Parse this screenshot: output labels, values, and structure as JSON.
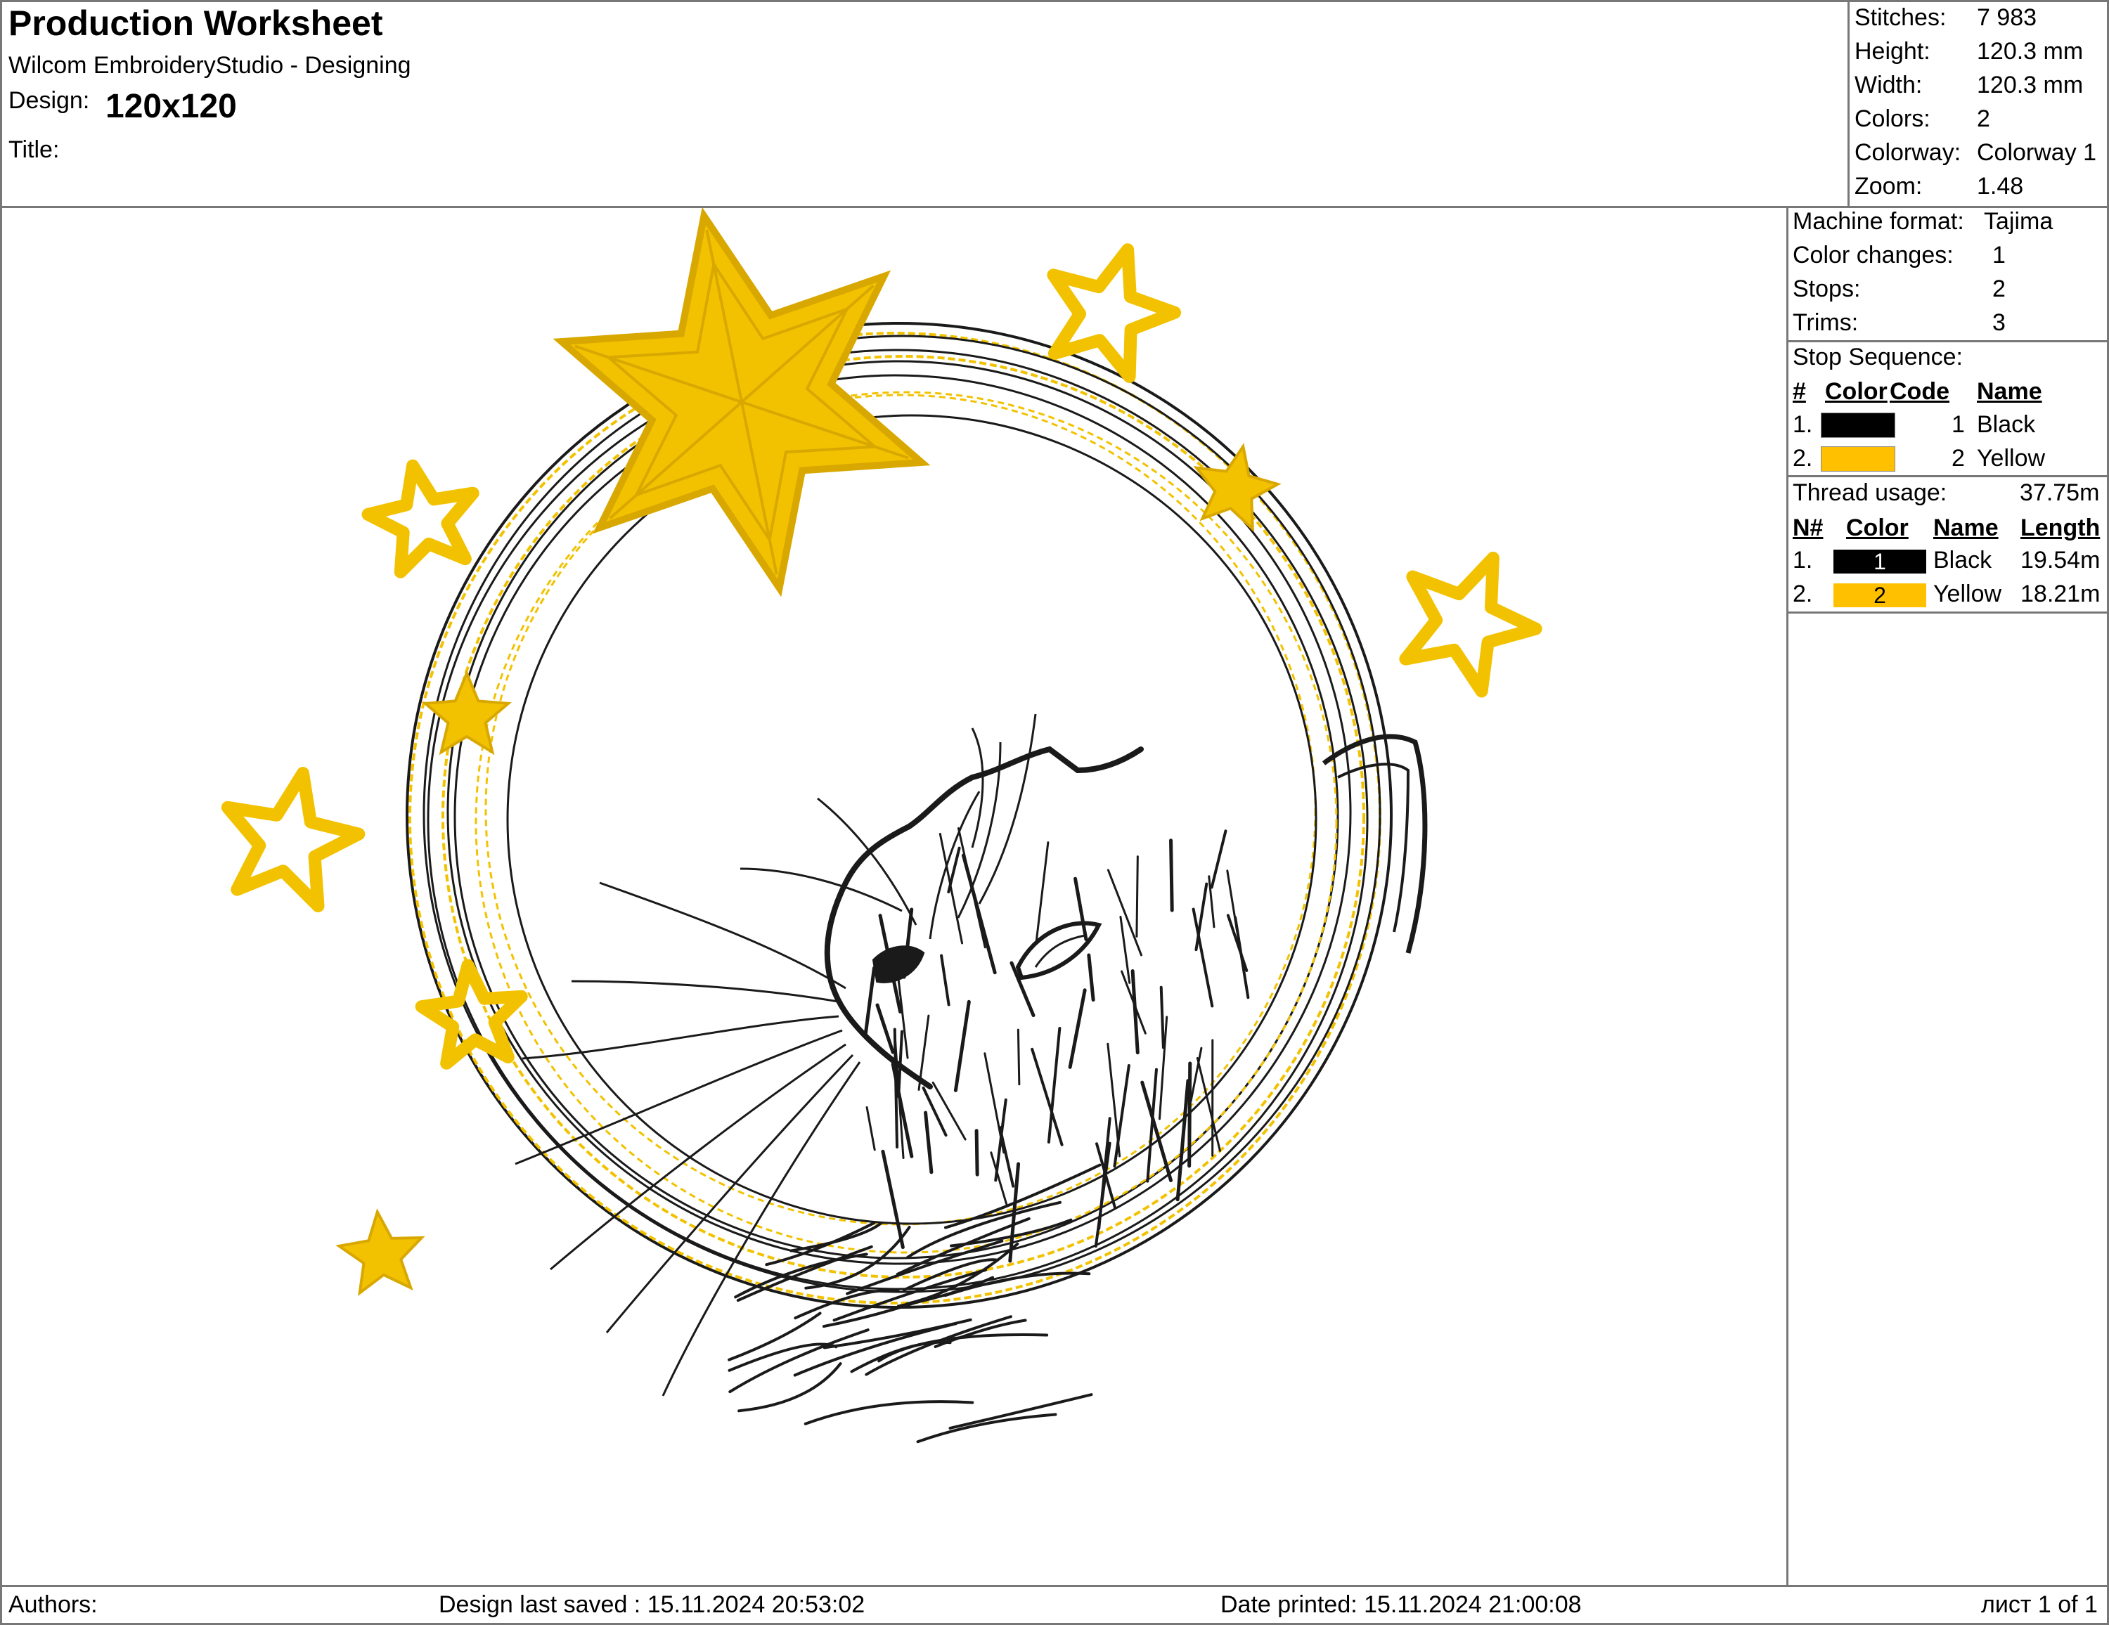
{
  "header": {
    "title": "Production Worksheet",
    "app": "Wilcom EmbroideryStudio - Designing",
    "design_label": "Design:",
    "design_value": "120x120",
    "title_label": "Title:",
    "title_value": ""
  },
  "stats": [
    {
      "label": "Stitches:",
      "value": "7 983"
    },
    {
      "label": "Height:",
      "value": "120.3 mm"
    },
    {
      "label": "Width:",
      "value": "120.3 mm"
    },
    {
      "label": "Colors:",
      "value": "2"
    },
    {
      "label": "Colorway:",
      "value": "Colorway 1"
    },
    {
      "label": "Zoom:",
      "value": "1.48"
    }
  ],
  "machine": [
    {
      "label": "Machine format:",
      "value": "Tajima"
    },
    {
      "label": "Color changes:",
      "value": "1"
    },
    {
      "label": "Stops:",
      "value": "2"
    },
    {
      "label": "Trims:",
      "value": "3"
    }
  ],
  "stop_sequence": {
    "heading": "Stop Sequence:",
    "columns": [
      "#",
      "Color",
      "Code",
      "Name"
    ],
    "rows": [
      {
        "num": "1.",
        "color": "#000000",
        "code": "1",
        "name": "Black"
      },
      {
        "num": "2.",
        "color": "#FFC000",
        "code": "2",
        "name": "Yellow"
      }
    ]
  },
  "thread_usage": {
    "heading": "Thread usage:",
    "total": "37.75m",
    "columns": [
      "N#",
      "Color",
      "Name",
      "Length"
    ],
    "rows": [
      {
        "num": "1.",
        "color": "#000000",
        "code": "1",
        "name": "Black",
        "length": "19.54m"
      },
      {
        "num": "2.",
        "color": "#FFC000",
        "code": "2",
        "name": "Yellow",
        "length": "18.21m"
      }
    ]
  },
  "footer": {
    "authors": "Authors:",
    "saved": "Design last saved : 15.11.2024 20:53:02",
    "printed": "Date printed: 15.11.2024 21:00:08",
    "page": "лист 1 of 1"
  },
  "design_colors": {
    "black": "#1a1a1a",
    "yellow": "#F2C200",
    "yellow_dark": "#D9A800"
  }
}
